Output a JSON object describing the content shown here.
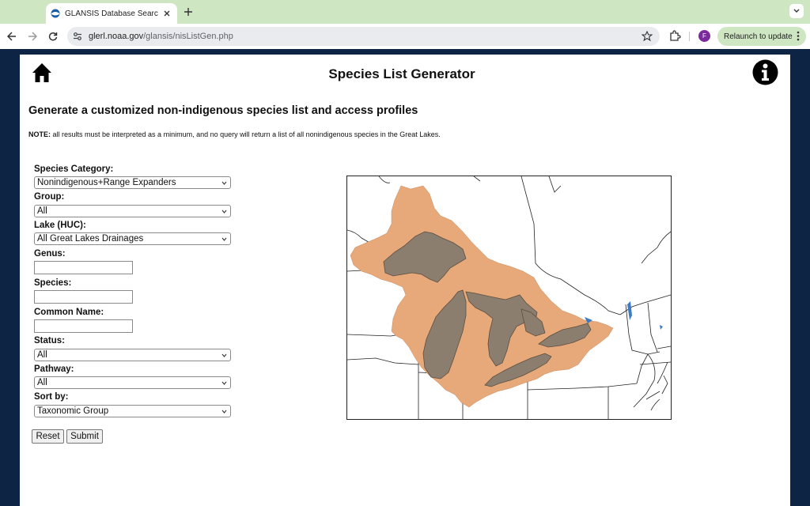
{
  "browser": {
    "tab_title": "GLANSIS Database Search: N",
    "url_domain": "glerl.noaa.gov",
    "url_path": "/glansis/nisListGen.php",
    "profile_initial": "F",
    "relaunch_label": "Relaunch to update",
    "accent": "#cfe6c2"
  },
  "page": {
    "title": "Species List Generator",
    "subtitle": "Generate a customized non-indigenous species list and access profiles",
    "note_label": "NOTE:",
    "note_text": " all results must be interpreted as a minimum, and no query will return a list of all nonindigenous species in the Great Lakes.",
    "icons": [
      "home-icon",
      "info-icon"
    ]
  },
  "form": {
    "species_category": {
      "label": "Species Category:",
      "value": "Nonindigenous+Range Expanders"
    },
    "group": {
      "label": "Group:",
      "value": "All"
    },
    "lake": {
      "label": "Lake (HUC):",
      "value": "All Great Lakes Drainages"
    },
    "genus": {
      "label": "Genus:",
      "value": ""
    },
    "species": {
      "label": "Species:",
      "value": ""
    },
    "common_name": {
      "label": "Common Name:",
      "value": ""
    },
    "status": {
      "label": "Status:",
      "value": "All"
    },
    "pathway": {
      "label": "Pathway:",
      "value": "All"
    },
    "sort_by": {
      "label": "Sort by:",
      "value": "Taxonomic Group"
    },
    "reset_label": "Reset",
    "submit_label": "Submit"
  },
  "map": {
    "basin_color": "#e8a97a",
    "lake_color": "#8c7e6e",
    "water_color": "#3c7cc4"
  }
}
